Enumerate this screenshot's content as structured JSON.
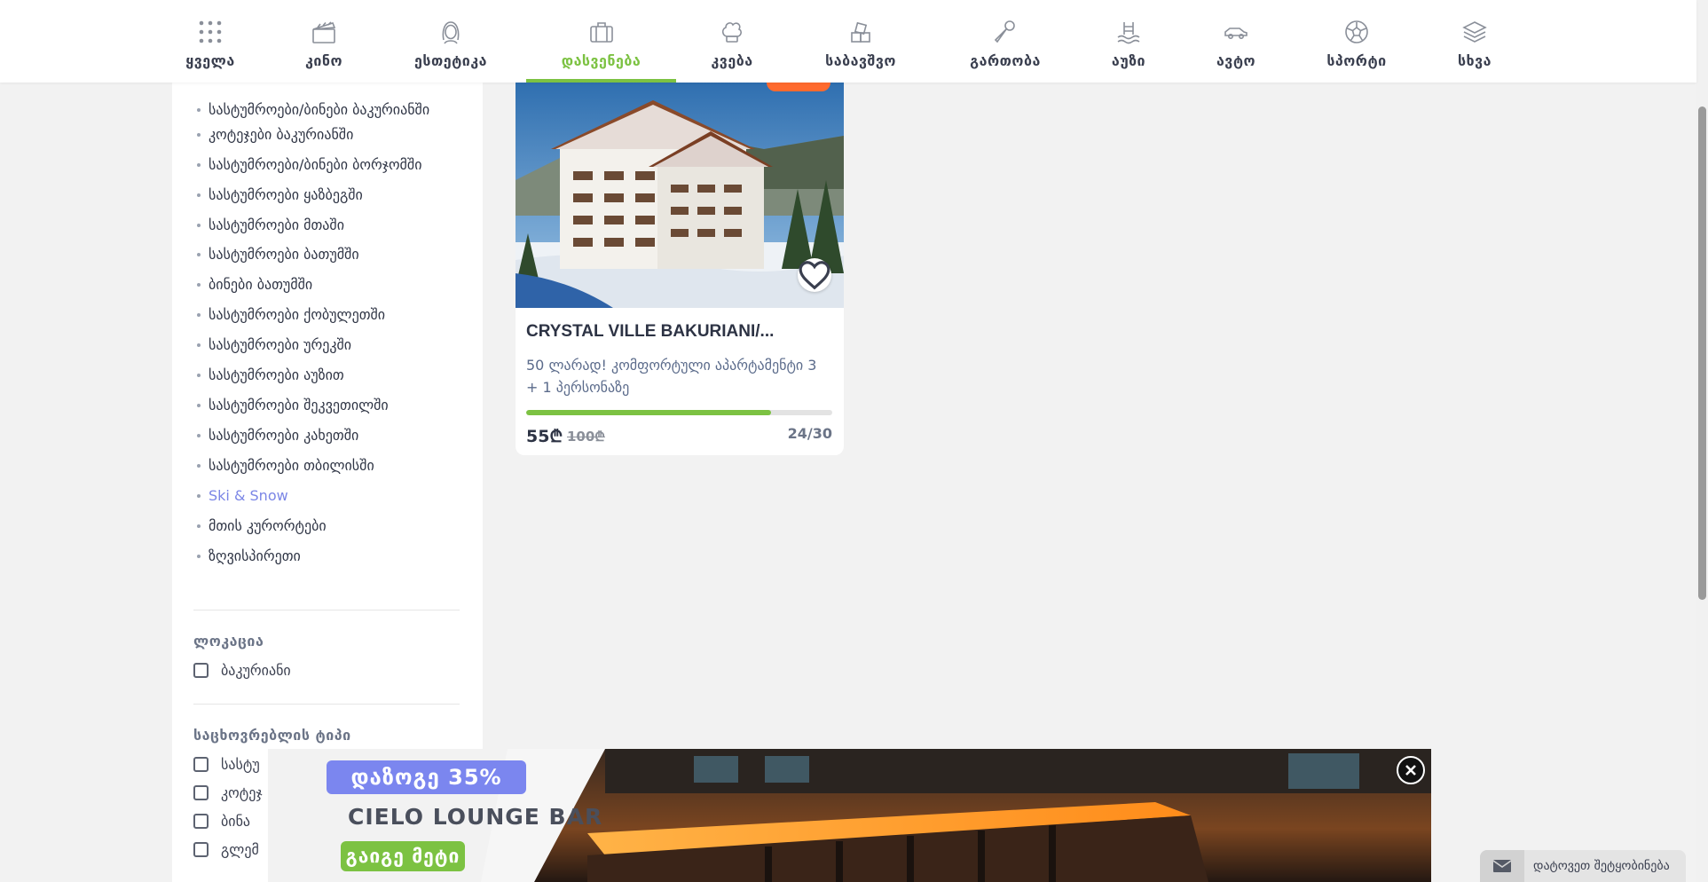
{
  "nav": {
    "items": [
      {
        "label": "ყველა",
        "icon": "grid-icon"
      },
      {
        "label": "კინო",
        "icon": "clapperboard-icon"
      },
      {
        "label": "ესთეტიკა",
        "icon": "woman-face-icon"
      },
      {
        "label": "დასვენება",
        "icon": "suitcase-icon"
      },
      {
        "label": "კვება",
        "icon": "chef-hat-icon"
      },
      {
        "label": "საბავშვო",
        "icon": "toy-blocks-icon"
      },
      {
        "label": "გართობა",
        "icon": "microphone-icon"
      },
      {
        "label": "აუზი",
        "icon": "pool-icon"
      },
      {
        "label": "ავტო",
        "icon": "car-icon"
      },
      {
        "label": "სპორტი",
        "icon": "soccer-ball-icon"
      },
      {
        "label": "სხვა",
        "icon": "layers-icon"
      }
    ],
    "active_index": 3,
    "accent_color": "#7cc242"
  },
  "sidebar": {
    "subcategories": [
      "სასტუმროები/ბინები ბაკურიანში",
      "კოტეჯები ბაკურიანში",
      "სასტუმროები/ბინები ბორჯომში",
      "სასტუმროები ყაზბეგში",
      "სასტუმროები მთაში",
      "სასტუმროები ბათუმში",
      "ბინები ბათუმში",
      "სასტუმროები ქობულეთში",
      "სასტუმროები ურეკში",
      "სასტუმროები აუზით",
      "სასტუმროები შეკვეთილში",
      "სასტუმროები კახეთში",
      "სასტუმროები თბილისში",
      "Ski & Snow",
      "მთის კურორტები",
      "ზღვისპირეთი"
    ],
    "highlighted_index": 13,
    "location": {
      "title": "ლოკაცია",
      "options": [
        "ბაკურიანი"
      ]
    },
    "accommodation": {
      "title": "საცხოვრებლის ტიპი",
      "options": [
        "სასტუ",
        "კოტეჯ",
        "ბინა",
        "გლემ"
      ]
    }
  },
  "offer": {
    "title": "CRYSTAL VILLE BAKURIANI/...",
    "description": "50 ლარად! კომფორტული აპარტამენტი 3 + 1 პერსონაზე",
    "price": "55₾",
    "old_price": "100₾",
    "sold": "24/30",
    "progress": 0.8
  },
  "banner": {
    "discount": "დაზოგე 35%",
    "title": "CIELO LOUNGE BAR",
    "button": "გაიგე მეტი"
  },
  "notify": {
    "label": "დატოვეთ შეტყობინება"
  }
}
